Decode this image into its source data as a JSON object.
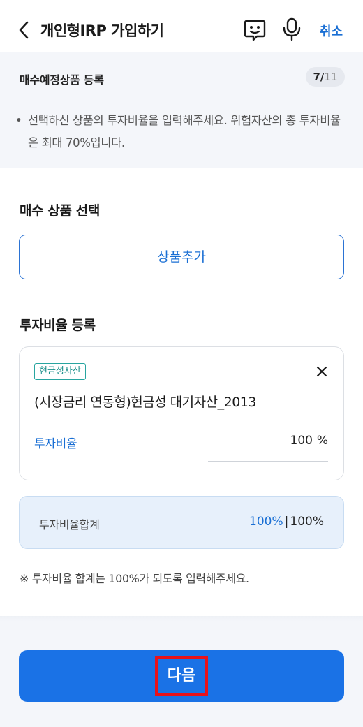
{
  "header": {
    "title": "개인형IRP 가입하기",
    "cancel_label": "취소",
    "icons": [
      "back-arrow-icon",
      "chatbot-icon",
      "microphone-icon"
    ]
  },
  "step": {
    "title": "매수예정상품 등록",
    "current": "7",
    "separator": "/",
    "total": "11",
    "note": "선택하신 상품의 투자비율을 입력해주세요. 위험자산의 총 투자비율은 최대 70%입니다."
  },
  "product_select": {
    "title": "매수 상품 선택",
    "add_button_label": "상품추가"
  },
  "ratio_section": {
    "title": "투자비율 등록",
    "product": {
      "tag": "현금성자산",
      "name": "(시장금리 연동형)현금성 대기자산_2013",
      "ratio_label": "투자비율",
      "ratio_value": "100",
      "ratio_unit": "%"
    },
    "summary": {
      "label": "투자비율합계",
      "current": "100%",
      "divider": "|",
      "max": "100%"
    },
    "notice": "※ 투자비율 합계는 100%가 되도록 입력해주세요."
  },
  "footer": {
    "next_label": "다음"
  },
  "colors": {
    "accent": "#1a72e6",
    "link_blue": "#1a6fd4",
    "tag_teal": "#28a5a0",
    "highlight_red": "#e8121b",
    "panel_bg": "#f4f6fa"
  }
}
